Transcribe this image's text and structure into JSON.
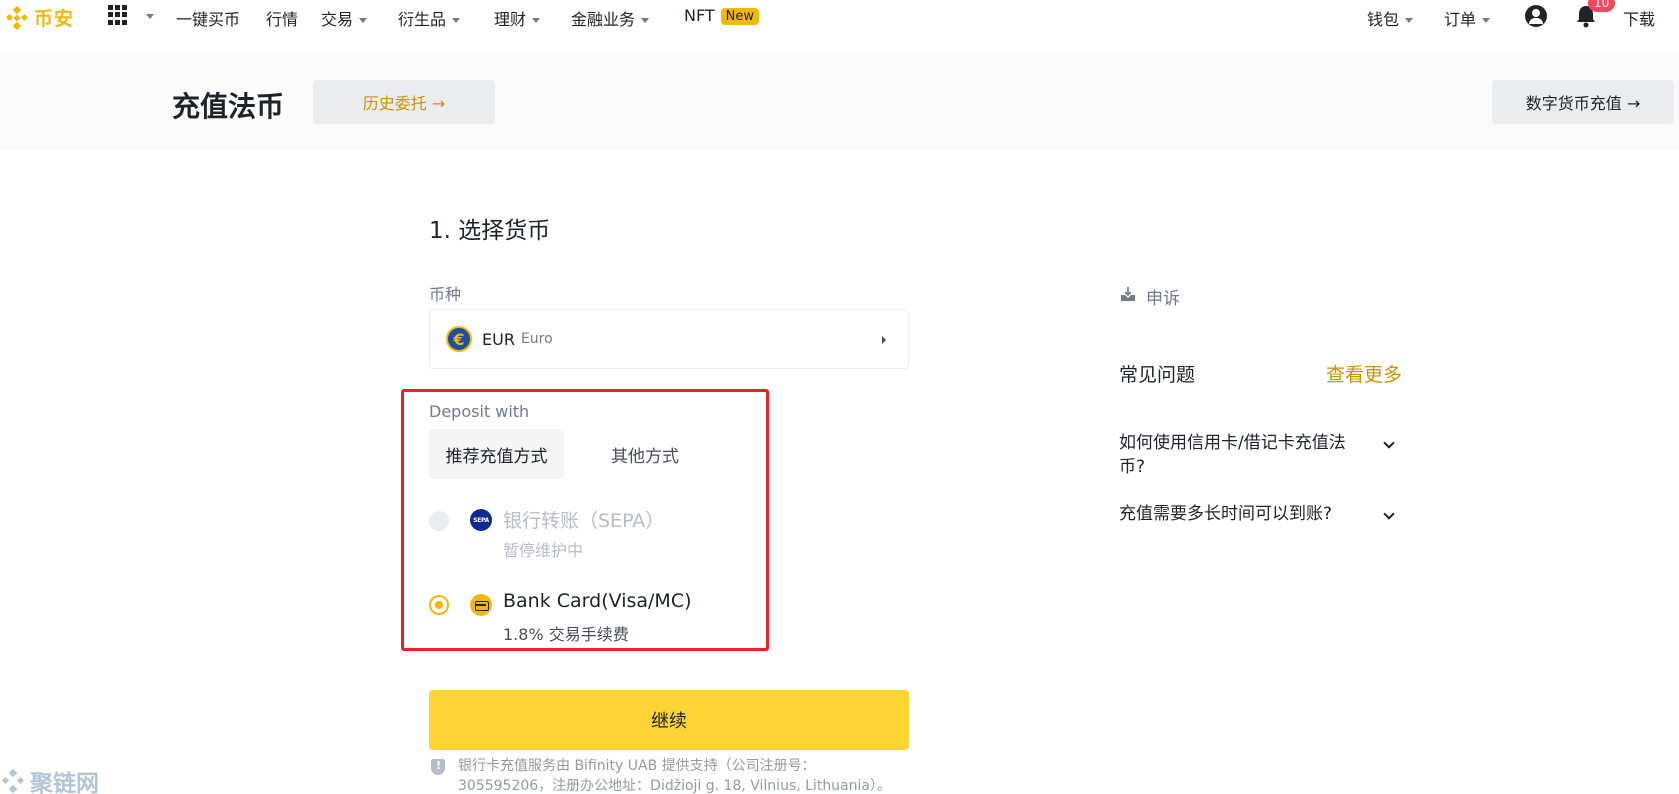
{
  "nav": {
    "brand": "币安",
    "items": [
      "一键买币",
      "行情",
      "交易",
      "衍生品",
      "理财",
      "金融业务",
      "NFT"
    ],
    "nft_badge": "New",
    "wallet": "钱包",
    "orders": "订单",
    "notif_count": "10",
    "download": "下载"
  },
  "header": {
    "title": "充值法币",
    "history_button": "历史委托 →",
    "crypto_button": "数字货币充值 →"
  },
  "form": {
    "step_title": "1. 选择货币",
    "currency_label": "币种",
    "currency_code": "EUR",
    "currency_name": "Euro",
    "currency_symbol": "€",
    "deposit_with": "Deposit with",
    "tabs": [
      "推荐充值方式",
      "其他方式"
    ],
    "methods": [
      {
        "icon": "sepa-icon",
        "icon_text": "SEPA",
        "title": "银行转账（SEPA）",
        "subtitle": "暂停维护中",
        "state": "disabled"
      },
      {
        "icon": "bank-card-icon",
        "title": "Bank Card(Visa/MC)",
        "subtitle": "1.8% 交易手续费",
        "state": "selected"
      }
    ],
    "continue_button": "继续",
    "footnote": "银行卡充值服务由 Bifinity UAB 提供支持（公司注册号：305595206，注册办公地址：Didžioji g. 18, Vilnius, Lithuania）。"
  },
  "sidebar": {
    "appeal": "申诉",
    "faq_title": "常见问题",
    "faq_more": "查看更多",
    "faqs": [
      "如何使用信用卡/借记卡充值法币?",
      "充值需要多长时间可以到账?"
    ]
  },
  "watermark": "聚链网",
  "colors": {
    "brand": "#f0b90b",
    "button": "#fcd535",
    "link": "#c99400",
    "highlight": "#ef1e2a"
  }
}
